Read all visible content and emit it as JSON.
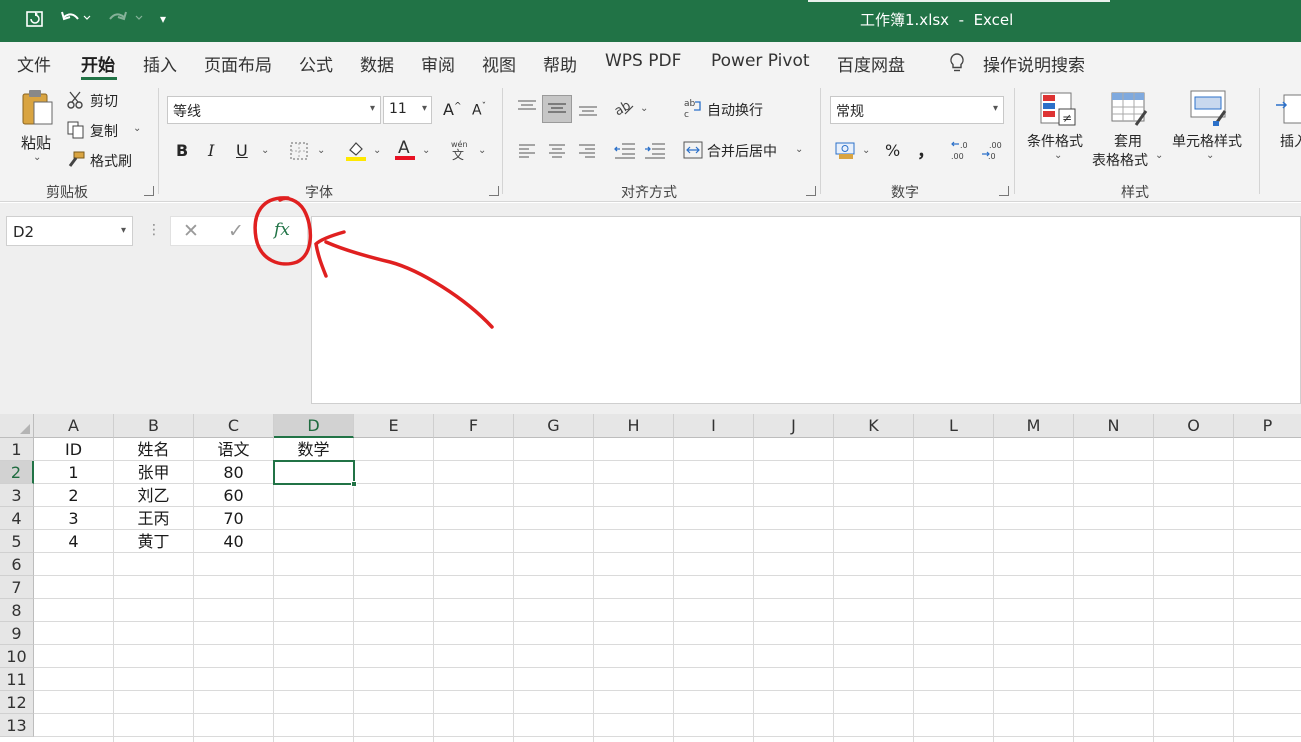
{
  "titlebar": {
    "filename": "工作簿1.xlsx",
    "separator": "-",
    "app": "Excel"
  },
  "tabs": [
    "文件",
    "开始",
    "插入",
    "页面布局",
    "公式",
    "数据",
    "审阅",
    "视图",
    "帮助",
    "WPS PDF",
    "Power Pivot",
    "百度网盘"
  ],
  "active_tab": "开始",
  "tell_me": "操作说明搜索",
  "clipboard": {
    "paste": "粘贴",
    "cut": "剪切",
    "copy": "复制",
    "format_painter": "格式刷",
    "label": "剪贴板"
  },
  "font": {
    "name": "等线",
    "size": "11",
    "label": "字体",
    "bold": "B",
    "italic": "I",
    "underline": "U"
  },
  "alignment": {
    "wrap_text": "自动换行",
    "merge_center": "合并后居中",
    "label": "对齐方式"
  },
  "number": {
    "format": "常规",
    "percent": "%",
    "comma": "，",
    "label": "数字"
  },
  "styles": {
    "conditional": "条件格式",
    "table_format_1": "套用",
    "table_format_2": "表格格式",
    "cell_styles": "单元格样式",
    "label": "样式"
  },
  "cells": {
    "insert": "插入"
  },
  "formula_bar": {
    "name_box": "D2",
    "fx": "fx"
  },
  "columns": [
    "A",
    "B",
    "C",
    "D",
    "E",
    "F",
    "G",
    "H",
    "I",
    "J",
    "K",
    "L",
    "M",
    "N",
    "O",
    "P"
  ],
  "rows": [
    "1",
    "2",
    "3",
    "4",
    "5",
    "6",
    "7",
    "8",
    "9",
    "10",
    "11",
    "12",
    "13"
  ],
  "table": [
    [
      "ID",
      "姓名",
      "语文",
      "数学"
    ],
    [
      "1",
      "张甲",
      "80",
      ""
    ],
    [
      "2",
      "刘乙",
      "60",
      ""
    ],
    [
      "3",
      "王丙",
      "70",
      ""
    ],
    [
      "4",
      "黄丁",
      "40",
      ""
    ]
  ],
  "selected_cell": "D2",
  "colors": {
    "excel_green": "#217346",
    "annotation_red": "#e02020"
  }
}
